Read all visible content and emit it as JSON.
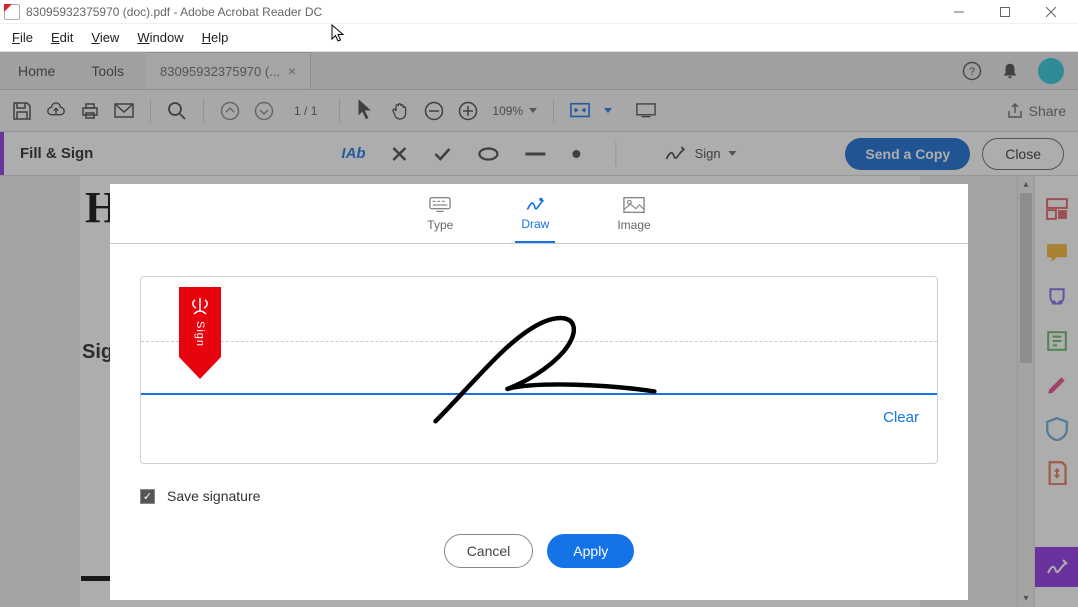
{
  "titlebar": {
    "title": "83095932375970 (doc).pdf - Adobe Acrobat Reader DC"
  },
  "menubar": {
    "file": "File",
    "edit": "Edit",
    "view": "View",
    "window": "Window",
    "help": "Help"
  },
  "tabs": {
    "home": "Home",
    "tools": "Tools",
    "file": "83095932375970 (..."
  },
  "toolbar": {
    "page": "1",
    "page_sep": "/",
    "page_total": "1",
    "zoom": "109%",
    "share": "Share"
  },
  "fillsign": {
    "title": "Fill & Sign",
    "sign": "Sign",
    "send": "Send a Copy",
    "close": "Close"
  },
  "doc": {
    "letter": "H",
    "sig": "Sig"
  },
  "modal": {
    "tabs": {
      "type": "Type",
      "draw": "Draw",
      "image": "Image"
    },
    "clear": "Clear",
    "marker_text": "Sign",
    "save_label": "Save signature",
    "cancel": "Cancel",
    "apply": "Apply"
  }
}
